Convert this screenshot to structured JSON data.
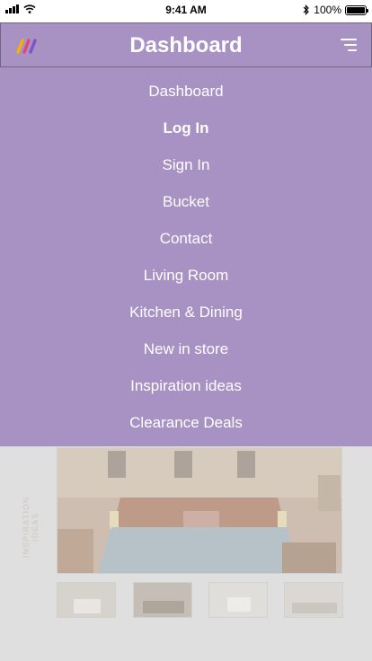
{
  "status_bar": {
    "time": "9:41 AM",
    "battery": "100%"
  },
  "header": {
    "title": "Dashboard",
    "logo_icon": "brand-logo-icon",
    "menu_icon": "hamburger-menu-icon"
  },
  "menu": {
    "items": [
      {
        "label": "Dashboard"
      },
      {
        "label": "Log In",
        "active": true
      },
      {
        "label": "Sign In"
      },
      {
        "label": "Bucket"
      },
      {
        "label": "Contact"
      },
      {
        "label": "Living Room"
      },
      {
        "label": "Kitchen & Dining"
      },
      {
        "label": "New in store"
      },
      {
        "label": "Inspiration ideas"
      },
      {
        "label": "Clearance Deals"
      }
    ]
  },
  "background": {
    "section_label": "INSPIRATION IDEAS"
  },
  "colors": {
    "menu_bg": "#a892c4",
    "header_border": "#6e6680",
    "text": "#ffffff"
  }
}
